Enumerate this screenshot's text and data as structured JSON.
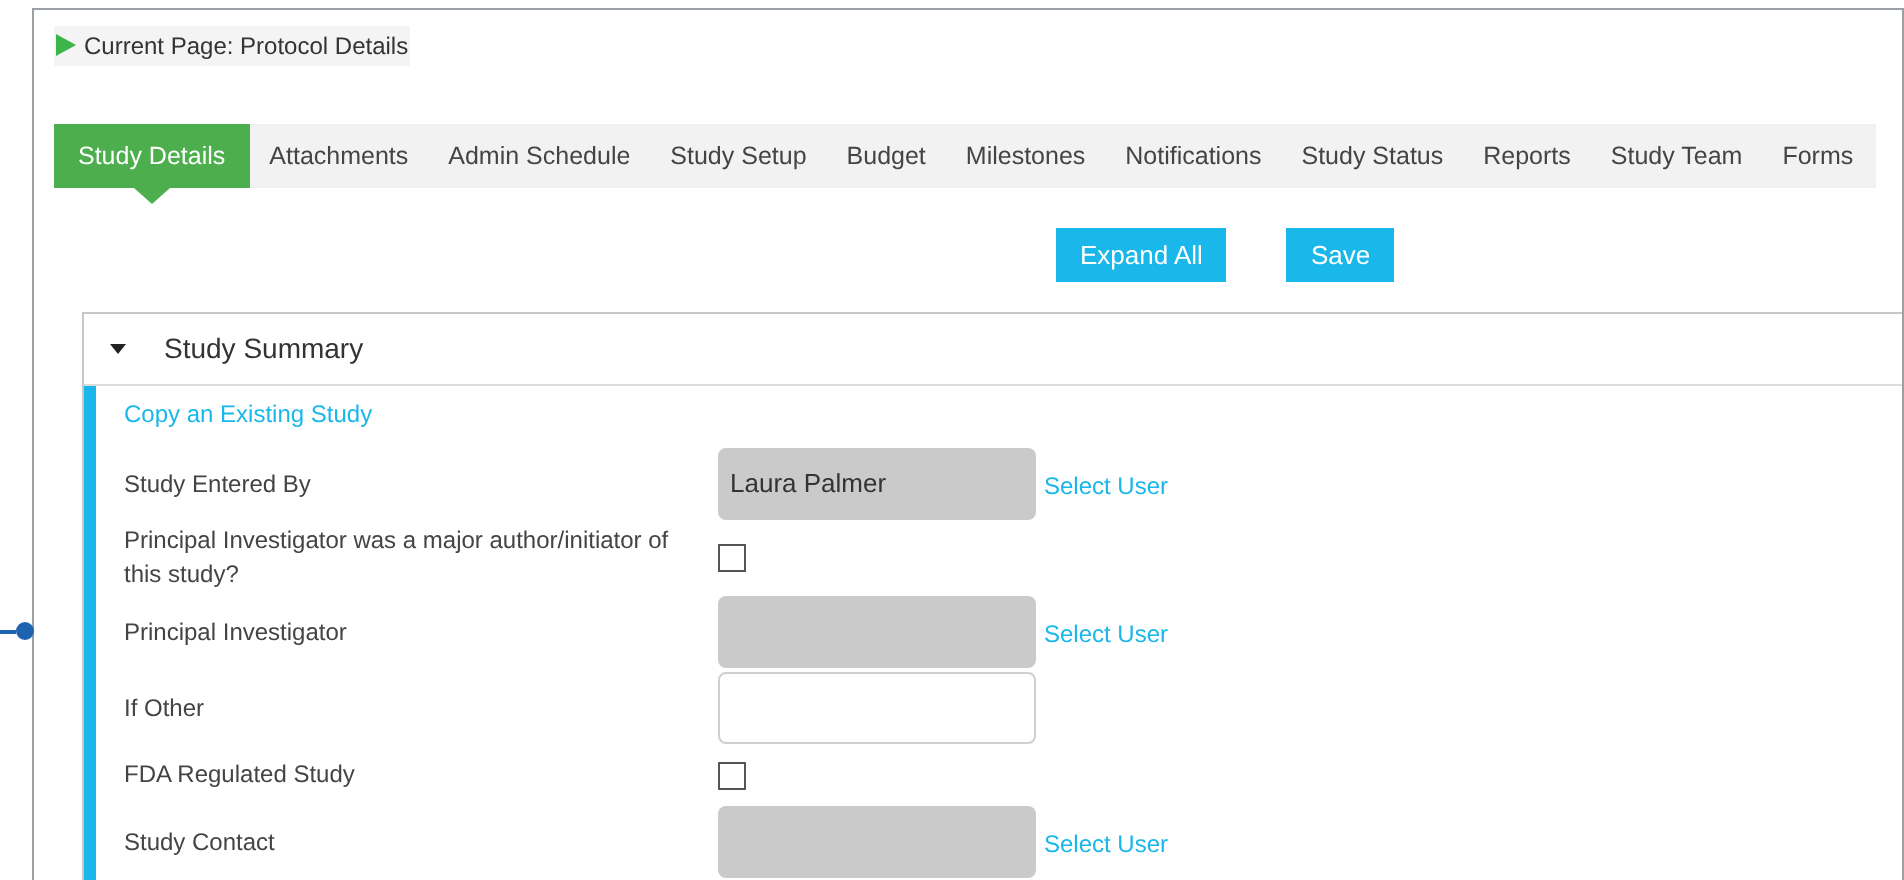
{
  "breadcrumb": "Current Page: Protocol Details",
  "tabs": [
    {
      "label": "Study Details",
      "selected": true
    },
    {
      "label": "Attachments",
      "selected": false
    },
    {
      "label": "Admin Schedule",
      "selected": false
    },
    {
      "label": "Study Setup",
      "selected": false
    },
    {
      "label": "Budget",
      "selected": false
    },
    {
      "label": "Milestones",
      "selected": false
    },
    {
      "label": "Notifications",
      "selected": false
    },
    {
      "label": "Study Status",
      "selected": false
    },
    {
      "label": "Reports",
      "selected": false
    },
    {
      "label": "Study Team",
      "selected": false
    },
    {
      "label": "Forms",
      "selected": false
    }
  ],
  "buttons": [
    "Expand All",
    "Save"
  ],
  "section": {
    "title": "Study Summary",
    "expanded": true,
    "link": "Copy an Existing Study",
    "fields": [
      {
        "kind": "user",
        "label": "Study Entered By",
        "value": "Laura Palmer",
        "action": "Select User"
      },
      {
        "kind": "checkbox",
        "label": "Principal Investigator was a major author/initiator of this study?",
        "checked": false
      },
      {
        "kind": "user",
        "label": "Principal Investigator",
        "action": "Select User"
      },
      {
        "kind": "text",
        "label": "If Other"
      },
      {
        "kind": "checkbox",
        "label": "FDA Regulated Study",
        "checked": false
      },
      {
        "kind": "user",
        "label": "Study Contact",
        "action": "Select User"
      }
    ]
  }
}
